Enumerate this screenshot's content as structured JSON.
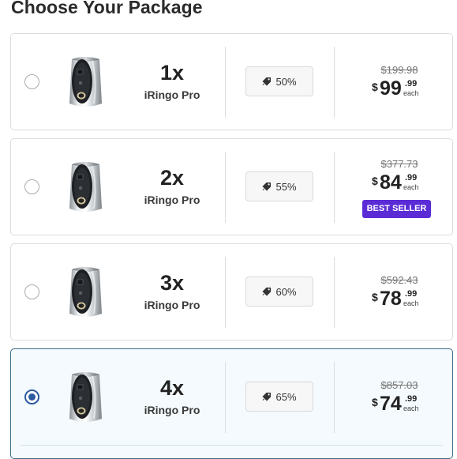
{
  "heading": "Choose Your Package",
  "colors": {
    "accent_radio": "#2c5aa0",
    "selected_border": "#3d6a86",
    "selected_background": "#f4fafd",
    "badge_background": "#5b2bd6"
  },
  "icons": {
    "radio": "radio-button-icon",
    "ring": "smart-ring-icon",
    "discount": "tag-icon"
  },
  "packages": [
    {
      "quantity": "1x",
      "product": "iRingo Pro",
      "discount": "50%",
      "old_price": "$199.98",
      "currency": "$",
      "price_whole": "99",
      "price_cents": ".99",
      "price_unit": "each",
      "badge": "",
      "selected": false
    },
    {
      "quantity": "2x",
      "product": "iRingo Pro",
      "discount": "55%",
      "old_price": "$377.73",
      "currency": "$",
      "price_whole": "84",
      "price_cents": ".99",
      "price_unit": "each",
      "badge": "BEST SELLER",
      "selected": false
    },
    {
      "quantity": "3x",
      "product": "iRingo Pro",
      "discount": "60%",
      "old_price": "$592.43",
      "currency": "$",
      "price_whole": "78",
      "price_cents": ".99",
      "price_unit": "each",
      "badge": "",
      "selected": false
    },
    {
      "quantity": "4x",
      "product": "iRingo Pro",
      "discount": "65%",
      "old_price": "$857.03",
      "currency": "$",
      "price_whole": "74",
      "price_cents": ".99",
      "price_unit": "each",
      "badge": "",
      "selected": true
    }
  ]
}
